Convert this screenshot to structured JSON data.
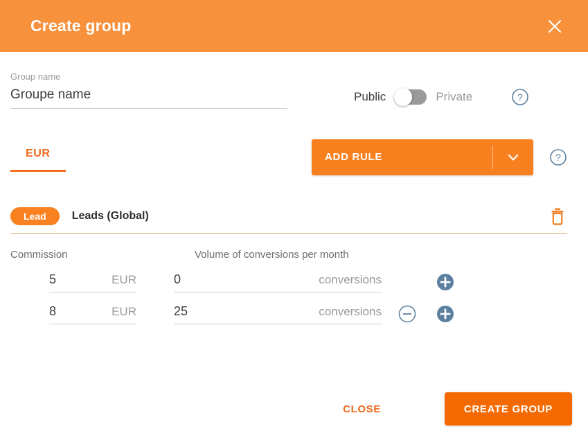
{
  "header": {
    "title": "Create group",
    "close_icon": "close-icon",
    "background_color": "#f7913c"
  },
  "group_name_field": {
    "label": "Group name",
    "value": "Groupe name",
    "placeholder": "Group name"
  },
  "visibility": {
    "public_label": "Public",
    "private_label": "Private",
    "state": "public",
    "help_icon": "help-circle-icon"
  },
  "currency_tabs": [
    {
      "label": "EUR",
      "active": true
    }
  ],
  "add_rule": {
    "label": "ADD RULE",
    "caret_icon": "chevron-down-icon",
    "help_icon": "help-circle-icon",
    "background_color": "#f9801e"
  },
  "rule": {
    "badge": "Lead",
    "title": "Leads (Global)",
    "delete_icon": "trash-icon",
    "columns": {
      "commission": "Commission",
      "volume": "Volume of conversions per month"
    },
    "tiers": [
      {
        "commission_value": "5",
        "commission_suffix": "EUR",
        "volume_value": "0",
        "volume_suffix": "conversions",
        "has_remove": false,
        "add_icon": "plus-circle-icon",
        "remove_icon": "minus-circle-icon"
      },
      {
        "commission_value": "8",
        "commission_suffix": "EUR",
        "volume_value": "25",
        "volume_suffix": "conversions",
        "has_remove": true,
        "add_icon": "plus-circle-icon",
        "remove_icon": "minus-circle-icon"
      }
    ]
  },
  "footer": {
    "close_label": "CLOSE",
    "create_label": "CREATE GROUP",
    "create_background_color": "#f56a00",
    "close_text_color": "#f2681c"
  },
  "colors": {
    "header_orange": "#f7913c",
    "accent_orange": "#f2681c",
    "button_orange": "#f9801e",
    "create_orange": "#f56a00",
    "icon_slate": "#5b7f9e",
    "label_gray": "#9a9a9a"
  }
}
